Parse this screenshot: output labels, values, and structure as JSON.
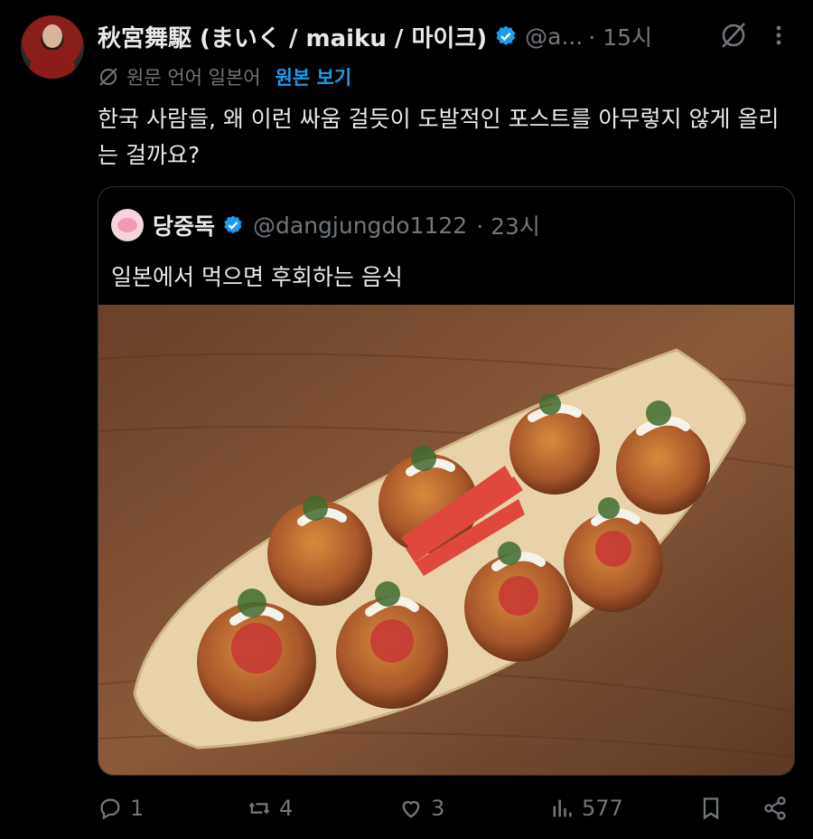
{
  "author": {
    "name": "秋宮舞駆 (まいく / maiku / 마이크)",
    "handle": "@a...",
    "time": "· 15시"
  },
  "translation": {
    "label": "원문 언어 일본어",
    "show_original": "원본 보기"
  },
  "tweet_text": "한국 사람들, 왜 이런 싸움 걸듯이 도발적인 포스트를 아무렇지 않게 올리는 걸까요?",
  "quote": {
    "name": "당중독",
    "handle": "@dangjungdo1122",
    "time": "· 23시",
    "text": "일본에서 먹으면 후회하는 음식"
  },
  "actions": {
    "replies": "1",
    "reposts": "4",
    "likes": "3",
    "views": "577"
  },
  "colors": {
    "accent": "#1d9bf0",
    "muted": "#71767b",
    "text": "#e7e9ea",
    "background": "#000000"
  }
}
